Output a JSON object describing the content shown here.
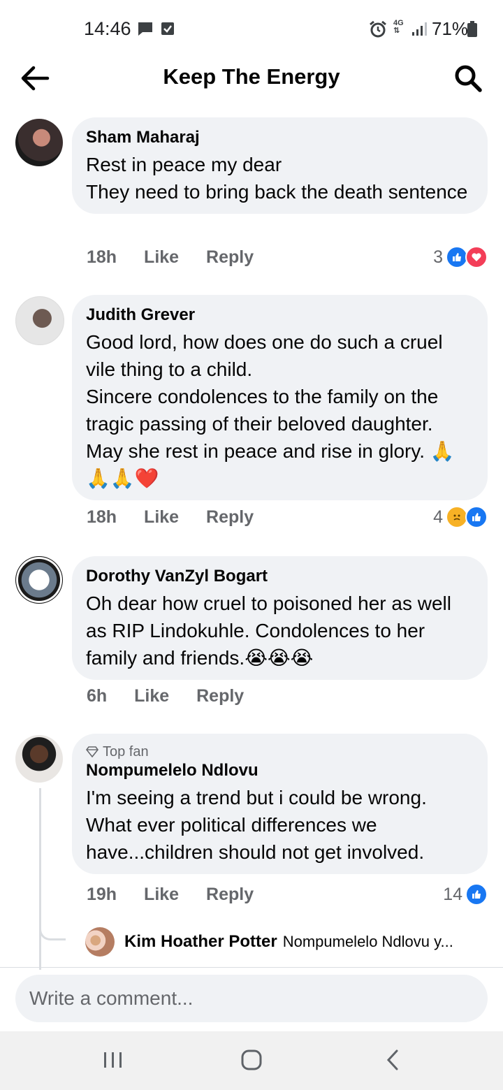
{
  "status_bar": {
    "time": "14:46",
    "battery": "71%",
    "network": "4G",
    "icons": [
      "message-icon",
      "check-icon",
      "alarm-icon",
      "network-4g-icon",
      "signal-icon",
      "battery-icon"
    ]
  },
  "header": {
    "title": "Keep The Energy",
    "back_icon": "back-arrow-icon",
    "search_icon": "search-icon"
  },
  "comments": [
    {
      "author": "Sham Maharaj",
      "text": "Rest in peace my dear\nThey need to bring back the death sentence",
      "time": "18h",
      "like_label": "Like",
      "reply_label": "Reply",
      "reaction_count": "3",
      "reactions": [
        "like",
        "love"
      ]
    },
    {
      "author": "Judith Grever",
      "text": "Good lord, how does  one do such a cruel vile thing to a child.\n Sincere condolences to the family on the tragic passing of their beloved daughter. May she  rest in peace and rise in glory. 🙏🙏🙏❤️",
      "time": "18h",
      "like_label": "Like",
      "reply_label": "Reply",
      "reaction_count": "4",
      "reactions": [
        "sad",
        "like"
      ]
    },
    {
      "author": "Dorothy VanZyl Bogart",
      "text": "Oh dear how cruel to poisoned her as well as RIP Lindokuhle. Condolences to her family and friends.😭😭😭",
      "time": "6h",
      "like_label": "Like",
      "reply_label": "Reply"
    },
    {
      "badge": "Top fan",
      "author": "Nompumelelo Ndlovu",
      "text": "I'm seeing a trend but i could be wrong. What ever political differences we have...children should not get involved.",
      "time": "19h",
      "like_label": "Like",
      "reply_label": "Reply",
      "reaction_count": "14",
      "reactions": [
        "like"
      ]
    }
  ],
  "reply_preview": {
    "author": "Kim Hoather Potter",
    "snippet": "Nompumelelo Ndlovu y..."
  },
  "composer": {
    "placeholder": "Write a comment..."
  },
  "nav": {
    "icons": [
      "recent-apps-icon",
      "home-icon",
      "back-icon"
    ]
  },
  "colors": {
    "bubble": "#f0f2f5",
    "secondary_text": "#65676b",
    "like_blue": "#1877f2",
    "love_red": "#f33e58"
  }
}
